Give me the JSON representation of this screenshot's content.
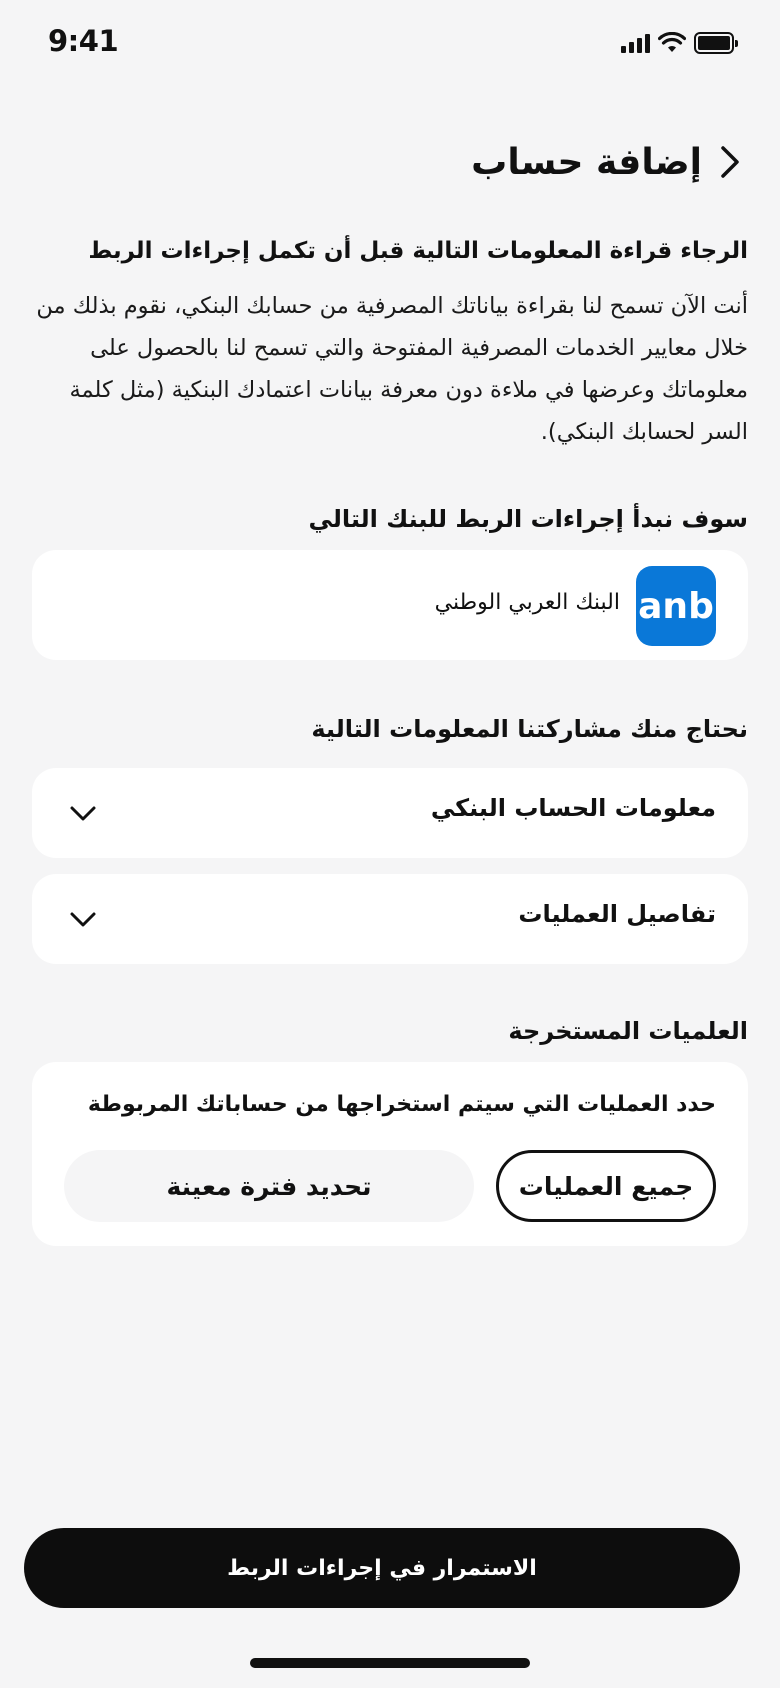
{
  "status_bar": {
    "time": "9:41",
    "icons": [
      "cellular-signal-icon",
      "wifi-icon",
      "battery-icon"
    ]
  },
  "header": {
    "title": "إضافة حساب",
    "back_icon": "chevron-right-icon"
  },
  "notice": {
    "title": "الرجاء قراءة المعلومات التالية قبل أن تكمل إجراءات الربط",
    "body": "أنت الآن تسمح لنا بقراءة بياناتك المصرفية من حسابك البنكي، نقوم بذلك من خلال معايير الخدمات المصرفية المفتوحة والتي تسمح لنا بالحصول على معلوماتك وعرضها في ملاءة دون معرفة بيانات اعتمادك البنكية (مثل كلمة السر لحسابك البنكي)."
  },
  "bank_section": {
    "heading": "سوف نبدأ إجراءات الربط للبنك التالي",
    "bank_name": "البنك العربي الوطني",
    "logo_text": "anb",
    "logo_color": "#0a78d8"
  },
  "info_section": {
    "heading": "نحتاج منك مشاركتنا المعلومات التالية",
    "items": [
      {
        "label": "معلومات الحساب البنكي"
      },
      {
        "label": "تفاصيل العمليات"
      }
    ]
  },
  "extract_section": {
    "heading": "العلميات المستخرجة",
    "subtitle": "حدد العمليات التي سيتم استخراجها من حساباتك المربوطة",
    "options": [
      {
        "label": "جميع العمليات",
        "selected": true
      },
      {
        "label": "تحديد فترة معينة",
        "selected": false
      }
    ]
  },
  "cta": {
    "label": "الاستمرار في إجراءات الربط"
  }
}
